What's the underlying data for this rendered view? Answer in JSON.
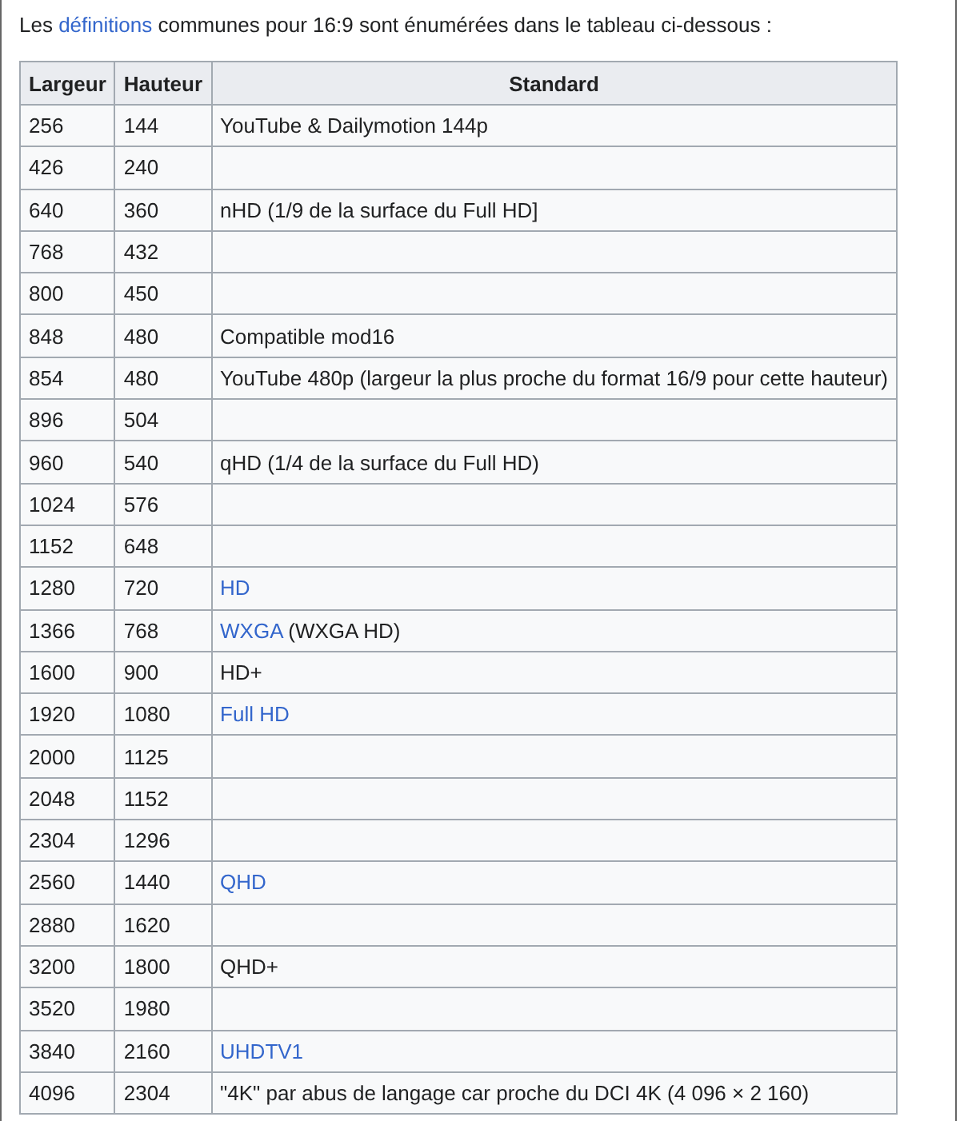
{
  "intro": {
    "parts": [
      {
        "text": "Les ",
        "link": false
      },
      {
        "text": "définitions",
        "link": true
      },
      {
        "text": " communes pour 16:9 sont énumérées dans le tableau ci-dessous :",
        "link": false
      }
    ]
  },
  "table": {
    "columns": [
      "Largeur",
      "Hauteur",
      "Standard"
    ],
    "rows": [
      {
        "largeur": "256",
        "hauteur": "144",
        "standard": [
          {
            "text": "YouTube & Dailymotion 144p",
            "link": false
          }
        ]
      },
      {
        "largeur": "426",
        "hauteur": "240",
        "standard": []
      },
      {
        "largeur": "640",
        "hauteur": "360",
        "standard": [
          {
            "text": "nHD (1/9 de la surface du Full HD]",
            "link": false
          }
        ]
      },
      {
        "largeur": "768",
        "hauteur": "432",
        "standard": []
      },
      {
        "largeur": "800",
        "hauteur": "450",
        "standard": []
      },
      {
        "largeur": "848",
        "hauteur": "480",
        "standard": [
          {
            "text": "Compatible mod16",
            "link": false
          }
        ]
      },
      {
        "largeur": "854",
        "hauteur": "480",
        "standard": [
          {
            "text": "YouTube 480p (largeur la plus proche du format 16/9 pour cette hauteur)",
            "link": false
          }
        ]
      },
      {
        "largeur": "896",
        "hauteur": "504",
        "standard": []
      },
      {
        "largeur": "960",
        "hauteur": "540",
        "standard": [
          {
            "text": "qHD (1/4 de la surface du Full HD)",
            "link": false
          }
        ]
      },
      {
        "largeur": "1024",
        "hauteur": "576",
        "standard": []
      },
      {
        "largeur": "1152",
        "hauteur": "648",
        "standard": []
      },
      {
        "largeur": "1280",
        "hauteur": "720",
        "standard": [
          {
            "text": "HD",
            "link": true
          }
        ]
      },
      {
        "largeur": "1366",
        "hauteur": "768",
        "standard": [
          {
            "text": "WXGA",
            "link": true
          },
          {
            "text": " (WXGA HD)",
            "link": false
          }
        ]
      },
      {
        "largeur": "1600",
        "hauteur": "900",
        "standard": [
          {
            "text": "HD+",
            "link": false
          }
        ]
      },
      {
        "largeur": "1920",
        "hauteur": "1080",
        "standard": [
          {
            "text": "Full HD",
            "link": true
          }
        ]
      },
      {
        "largeur": "2000",
        "hauteur": "1125",
        "standard": []
      },
      {
        "largeur": "2048",
        "hauteur": "1152",
        "standard": []
      },
      {
        "largeur": "2304",
        "hauteur": "1296",
        "standard": []
      },
      {
        "largeur": "2560",
        "hauteur": "1440",
        "standard": [
          {
            "text": "QHD",
            "link": true
          }
        ]
      },
      {
        "largeur": "2880",
        "hauteur": "1620",
        "standard": []
      },
      {
        "largeur": "3200",
        "hauteur": "1800",
        "standard": [
          {
            "text": "QHD+",
            "link": false
          }
        ]
      },
      {
        "largeur": "3520",
        "hauteur": "1980",
        "standard": []
      },
      {
        "largeur": "3840",
        "hauteur": "2160",
        "standard": [
          {
            "text": "UHDTV1",
            "link": true
          }
        ]
      },
      {
        "largeur": "4096",
        "hauteur": "2304",
        "standard": [
          {
            "text": "\"4K\" par abus de langage car proche du DCI 4K (4 096 × 2 160)",
            "link": false
          }
        ]
      }
    ]
  }
}
